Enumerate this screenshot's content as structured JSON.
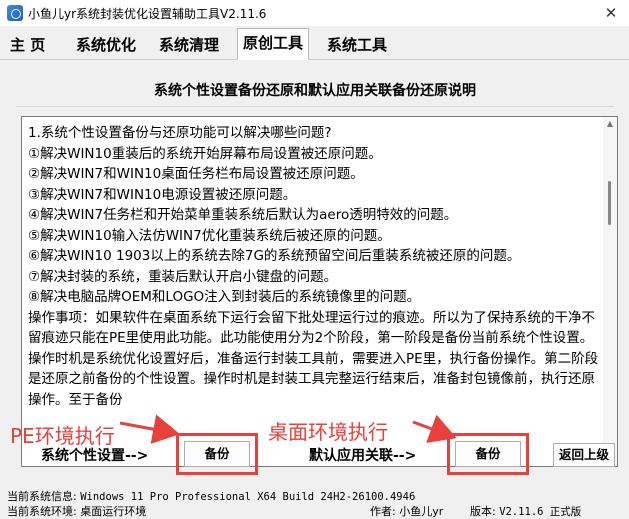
{
  "window": {
    "title": "小鱼儿yr系统封装优化设置辅助工具V2.11.6",
    "close_glyph": "✕"
  },
  "tabs": [
    {
      "label": "主 页",
      "active": false
    },
    {
      "label": "系统优化",
      "active": false
    },
    {
      "label": "系统清理",
      "active": false
    },
    {
      "label": "原创工具",
      "active": true
    },
    {
      "label": "系统工具",
      "active": false
    }
  ],
  "section": {
    "heading": "系统个性设置备份还原和默认应用关联备份还原说明"
  },
  "description": {
    "lines": [
      "1.系统个性设置备份与还原功能可以解决哪些问题?",
      "①解决WIN10重装后的系统开始屏幕布局设置被还原问题。",
      "②解决WIN7和WIN10桌面任务栏布局设置被还原问题。",
      "③解决WIN7和WIN10电源设置被还原问题。",
      "④解决WIN7任务栏和开始菜单重装系统后默认为aero透明特效的问题。",
      "⑤解决WIN10输入法仿WIN7优化重装系统后被还原的问题。",
      "⑥解决WIN10 1903以上的系统去除7G的系统预留空间后重装系统被还原的问题。",
      "⑦解决封装的系统，重装后默认开启小键盘的问题。",
      "⑧解决电脑品牌OEM和LOGO注入到封装后的系统镜像里的问题。"
    ],
    "paragraph": "操作事项：如果软件在桌面系统下运行会留下批处理运行过的痕迹。所以为了保持系统的干净不留痕迹只能在PE里使用此功能。此功能使用分为2个阶段，第一阶段是备份当前系统个性设置。操作时机是系统优化设置好后，准备运行封装工具前，需要进入PE里，执行备份操作。第二阶段是还原之前备份的个性设置。操作时机是封装工具完整运行结束后，准备封包镜像前，执行还原操作。至于备份"
  },
  "annotations": {
    "pe_env": "PE环境执行",
    "desktop_env": "桌面环境执行",
    "color": "#e8403a"
  },
  "actions": {
    "personal_label": "系统个性设置-->",
    "personal_button": "备份",
    "assoc_label": "默认应用关联-->",
    "assoc_button": "备份",
    "back_button": "返回上级"
  },
  "statusbar": {
    "sysinfo_label": "当前系统信息:",
    "sysinfo_value": "Windows 11 Pro Professional X64 Build 24H2-26100.4946",
    "env_label": "当前系统环境:",
    "env_value": "桌面运行环境",
    "author_label": "作者:",
    "author_value": "小鱼儿yr",
    "version_label": "版本:",
    "version_value": "V2.11.6 正式版"
  }
}
